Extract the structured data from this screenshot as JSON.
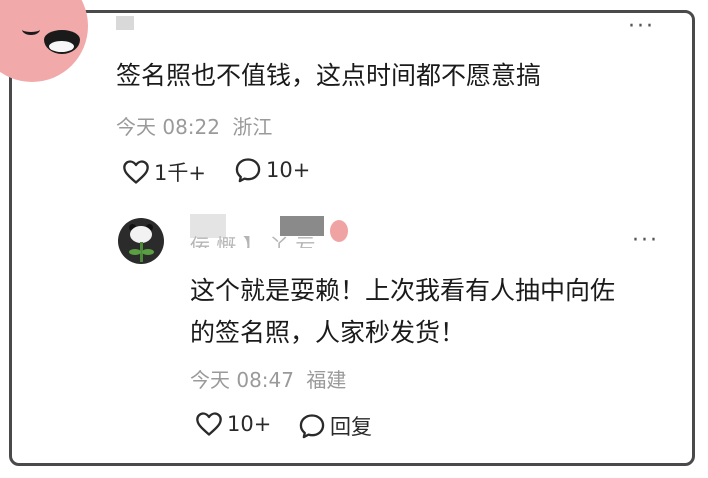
{
  "main_comment": {
    "text": "签名照也不值钱，这点时间都不愿意搞",
    "time": "今天 08:22",
    "location": "浙江",
    "likes": "1千+",
    "replies": "10+",
    "more_icon": "more-dots-icon"
  },
  "reply_comment": {
    "username_partial": "佞 慨 】 丫 亏",
    "text_line1": "这个就是耍赖！上次我看有人抽中向佐",
    "text_line2": "的签名照，人家秒发货！",
    "time": "今天 08:47",
    "location": "福建",
    "likes": "10+",
    "reply_label": "回复",
    "more_icon": "more-dots-icon"
  },
  "colors": {
    "text": "#1a1a1a",
    "meta": "#9a9a9a",
    "avatar_pink": "#f2a9aa",
    "border": "#4a4a4a"
  }
}
